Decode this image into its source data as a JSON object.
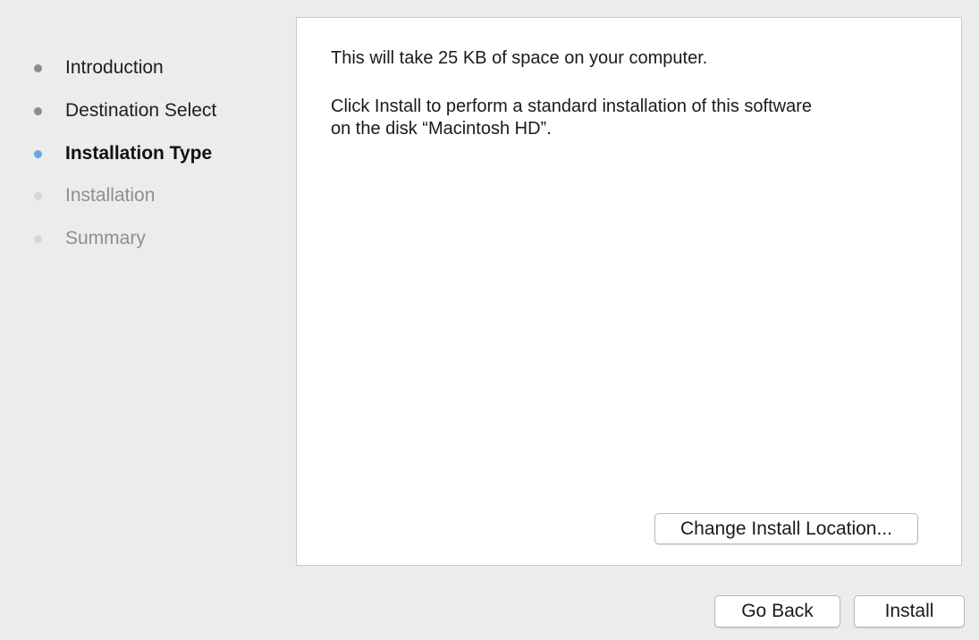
{
  "sidebar": {
    "steps": [
      {
        "label": "Introduction",
        "state": "done"
      },
      {
        "label": "Destination Select",
        "state": "done"
      },
      {
        "label": "Installation Type",
        "state": "current"
      },
      {
        "label": "Installation",
        "state": "pending"
      },
      {
        "label": "Summary",
        "state": "pending"
      }
    ]
  },
  "main": {
    "space_text": "This will take 25 KB of space on your computer.",
    "install_text_line1": "Click Install to perform a standard installation of this software",
    "install_text_line2": "on the disk “Macintosh HD”.",
    "change_location_label": "Change Install Location..."
  },
  "footer": {
    "go_back_label": "Go Back",
    "install_label": "Install"
  },
  "colors": {
    "current_step_dot": "#6aa5dc",
    "done_step_dot": "#8c8c8c",
    "pending_step_dot": "#d6d6d6",
    "window_background": "#ececec"
  }
}
